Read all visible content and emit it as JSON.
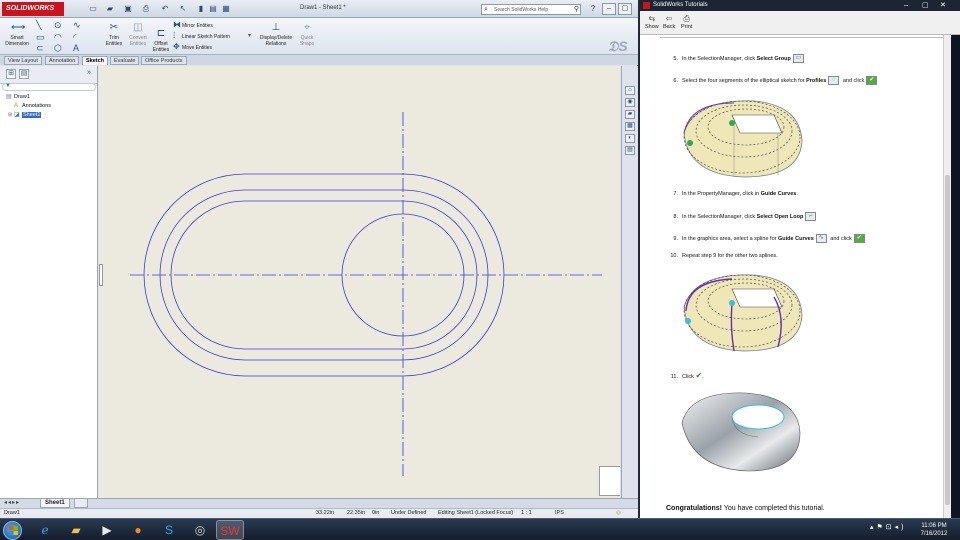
{
  "solidworks": {
    "logo": "SOLIDWORKS",
    "document_title": "Draw1 - Sheet1 *",
    "search_placeholder": "Search SolidWorks Help",
    "ribbon": {
      "smart_dimension": "Smart Dimension",
      "trim_entities": "Trim Entities",
      "convert_entities": "Convert Entities",
      "offset_entities": "Offset Entities",
      "mirror_entities": "Mirror Entities",
      "linear_sketch_pattern": "Linear Sketch Pattern",
      "move_entities": "Move Entities",
      "display_delete_relations": "Display/Delete Relations",
      "quick_snaps": "Quick Snaps"
    },
    "tabs": [
      "View Layout",
      "Annotation",
      "Sketch",
      "Evaluate",
      "Office Products"
    ],
    "active_tab": "Sketch",
    "tree": {
      "root": "Draw1",
      "annotations": "Annotations",
      "sheet": "Sheet1"
    },
    "sheet_tab": "Sheet1",
    "status": {
      "doc": "Draw1",
      "x": "33.22in",
      "y": "22.35in",
      "z": "0in",
      "state": "Under Defined",
      "editing": "Editing Sheet1 (Locked Focus)",
      "scale": "1 : 1",
      "units": "IPS"
    }
  },
  "help": {
    "title": "SolidWorks Tutorials",
    "toolbar": {
      "show": "Show",
      "back": "Back",
      "print": "Print"
    },
    "steps": [
      {
        "num": "5.",
        "pre": "In the SelectionManager, click ",
        "bold": "Select Group",
        "post": ""
      },
      {
        "num": "6.",
        "pre": "Select the four segments of the elliptical sketch for ",
        "bold": "Profiles",
        "post": " and click"
      },
      {
        "num": "7.",
        "pre": "In the PropertyManager, click in ",
        "bold": "Guide Curves",
        "post": "."
      },
      {
        "num": "8.",
        "pre": "In the SelectionManager, click ",
        "bold": "Select Open Loop",
        "post": ""
      },
      {
        "num": "9.",
        "pre": "In the graphics area, select a spline for ",
        "bold": "Guide Curves",
        "post": " and click"
      },
      {
        "num": "10.",
        "pre": "Repeat step 9 for the other two splines.",
        "bold": "",
        "post": ""
      },
      {
        "num": "11.",
        "pre": "Click ",
        "bold": "",
        "post": "."
      }
    ],
    "congrats_bold": "Congratulations!",
    "congrats_text": " You have completed this tutorial."
  },
  "taskbar": {
    "time": "11:06 PM",
    "date": "7/16/2012"
  },
  "colors": {
    "sketch_line": "#3a3ad8",
    "solidworks_red": "#c9141c",
    "selection_blue": "#3468c4"
  }
}
